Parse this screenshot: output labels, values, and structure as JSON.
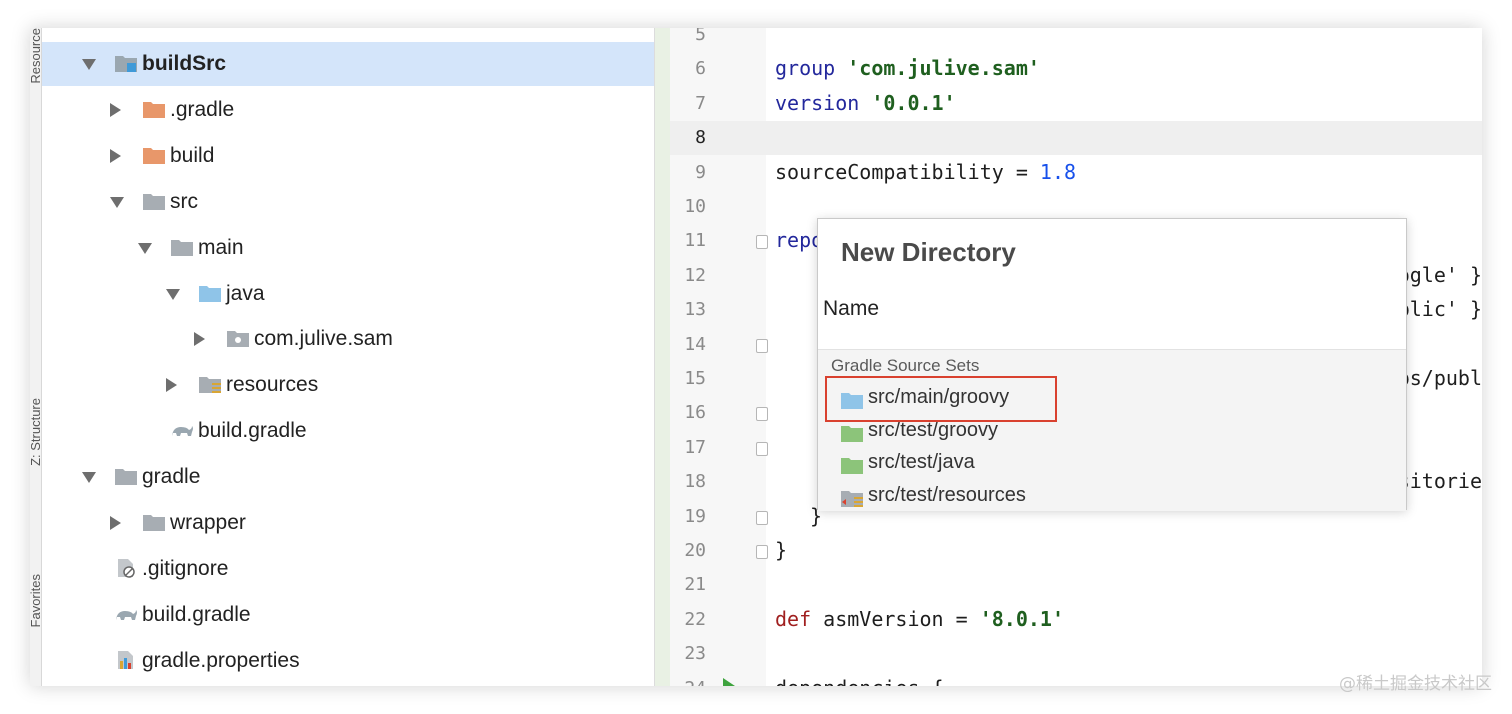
{
  "tool_strip": {
    "tabs": [
      "Resource",
      "Z: Structure",
      "Favorites"
    ]
  },
  "tree": [
    {
      "label": "buildSrc",
      "depth": 1,
      "expanded": true,
      "icon": "module-folder-icon",
      "bold": true,
      "selected": true
    },
    {
      "label": ".gradle",
      "depth": 2,
      "expanded": false,
      "icon": "excluded-folder-icon"
    },
    {
      "label": "build",
      "depth": 2,
      "expanded": false,
      "icon": "excluded-folder-icon"
    },
    {
      "label": "src",
      "depth": 2,
      "expanded": true,
      "icon": "folder-icon"
    },
    {
      "label": "main",
      "depth": 3,
      "expanded": true,
      "icon": "folder-icon"
    },
    {
      "label": "java",
      "depth": 4,
      "expanded": true,
      "icon": "source-folder-icon"
    },
    {
      "label": "com.julive.sam",
      "depth": 5,
      "expanded": false,
      "icon": "package-icon"
    },
    {
      "label": "resources",
      "depth": 4,
      "expanded": false,
      "icon": "resources-folder-icon"
    },
    {
      "label": "build.gradle",
      "depth": 3,
      "expanded": null,
      "icon": "gradle-icon"
    },
    {
      "label": "gradle",
      "depth": 1,
      "expanded": true,
      "icon": "folder-icon"
    },
    {
      "label": "wrapper",
      "depth": 2,
      "expanded": false,
      "icon": "folder-icon"
    },
    {
      "label": ".gitignore",
      "depth": 1,
      "expanded": null,
      "icon": "gitignore-icon"
    },
    {
      "label": "build.gradle",
      "depth": 1,
      "expanded": null,
      "icon": "gradle-icon"
    },
    {
      "label": "gradle.properties",
      "depth": 1,
      "expanded": null,
      "icon": "properties-icon"
    }
  ],
  "editor": {
    "current_line": 8,
    "lines": [
      {
        "n": "5",
        "code": ""
      },
      {
        "n": "6",
        "code": "group 'com.julive.sam'"
      },
      {
        "n": "7",
        "code": "version '0.0.1'"
      },
      {
        "n": "8",
        "code": ""
      },
      {
        "n": "9",
        "code": "sourceCompatibility = 1.8"
      },
      {
        "n": "10",
        "code": ""
      },
      {
        "n": "11",
        "code": "repo"
      },
      {
        "n": "12",
        "code": "ogle' }"
      },
      {
        "n": "13",
        "code": "blic' }"
      },
      {
        "n": "14",
        "code": ""
      },
      {
        "n": "15",
        "code": "ps/publ"
      },
      {
        "n": "16",
        "code": ""
      },
      {
        "n": "17",
        "code": ""
      },
      {
        "n": "18",
        "code": "sitorie"
      },
      {
        "n": "19",
        "code": "}"
      },
      {
        "n": "20",
        "code": "}"
      },
      {
        "n": "21",
        "code": ""
      },
      {
        "n": "22",
        "code": "def asmVersion = '8.0.1'"
      },
      {
        "n": "23",
        "code": ""
      },
      {
        "n": "24",
        "code": "dependencies {"
      }
    ]
  },
  "popup": {
    "title": "New Directory",
    "name_label": "Name",
    "group_label": "Gradle Source Sets",
    "items": [
      {
        "label": "src/main/groovy",
        "icon": "source-folder-icon",
        "highlighted": true
      },
      {
        "label": "src/test/groovy",
        "icon": "test-folder-icon"
      },
      {
        "label": "src/test/java",
        "icon": "test-folder-icon"
      },
      {
        "label": "src/test/resources",
        "icon": "test-resources-folder-icon"
      }
    ]
  },
  "colors": {
    "selection": "#d4e5fa",
    "highlight_border": "#d9412f",
    "keyword": "#23289c",
    "string": "#1f5f1f",
    "number": "#1750eb",
    "def_keyword": "#a01f1f"
  },
  "watermark": "@稀土掘金技术社区"
}
